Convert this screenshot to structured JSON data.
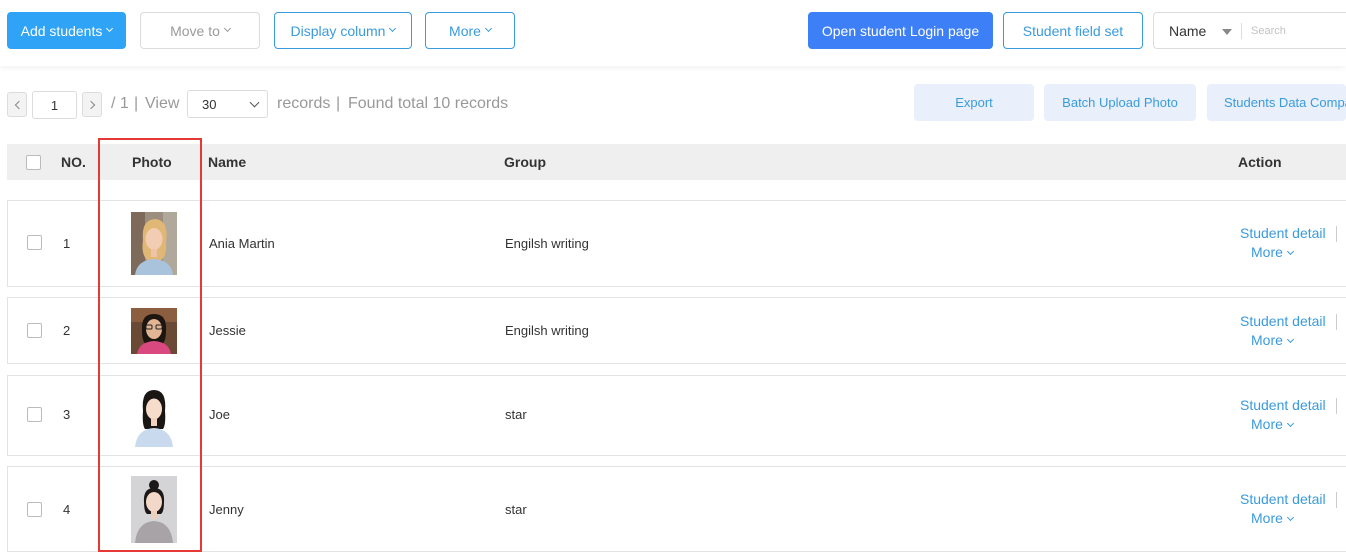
{
  "toolbar": {
    "add_students": "Add students",
    "move_to": "Move to",
    "display_column": "Display column",
    "more": "More",
    "open_login": "Open student Login page",
    "student_field_set": "Student field set",
    "search_field": "Name",
    "search_placeholder": "Search"
  },
  "pager": {
    "page": "1",
    "total_pages": "/ 1",
    "view_label": "View",
    "per_page": "30",
    "records_label": "records",
    "found_text": "Found total 10 records"
  },
  "actions_bar": {
    "export": "Export",
    "batch_upload": "Batch Upload Photo",
    "data_compare": "Students Data Compare"
  },
  "table": {
    "headers": {
      "no": "NO.",
      "photo": "Photo",
      "name": "Name",
      "group": "Group",
      "action": "Action"
    },
    "rows": [
      {
        "no": "1",
        "name": "Ania Martin",
        "group": "Engilsh writing",
        "detail": "Student detail",
        "more": "More"
      },
      {
        "no": "2",
        "name": "Jessie",
        "group": "Engilsh writing",
        "detail": "Student detail",
        "more": "More"
      },
      {
        "no": "3",
        "name": "Joe",
        "group": "star",
        "detail": "Student detail",
        "more": "More"
      },
      {
        "no": "4",
        "name": "Jenny",
        "group": "star",
        "detail": "Student detail",
        "more": "More"
      }
    ]
  },
  "colors": {
    "accent": "#2fa3f5",
    "primary": "#3d7ff6",
    "link": "#3a9bdc",
    "highlight": "#e53935"
  }
}
